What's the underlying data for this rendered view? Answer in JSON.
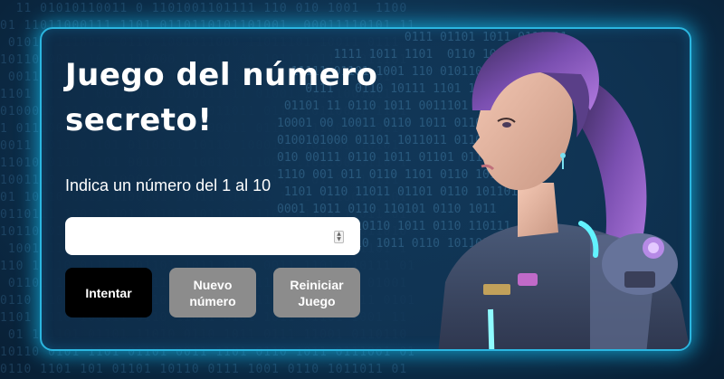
{
  "header": {
    "title": "Juego del número secreto!",
    "instruction": "Indica un número del 1 al 10"
  },
  "input": {
    "value": "",
    "placeholder": ""
  },
  "buttons": {
    "try_label": "Intentar",
    "new_number_label": "Nuevo número",
    "reset_label": "Reiniciar Juego"
  },
  "colors": {
    "glow": "#2bb6e0",
    "primary_button": "#000000",
    "disabled_button": "#8c8c8c"
  },
  "illustration": "astronaut-girl-image"
}
